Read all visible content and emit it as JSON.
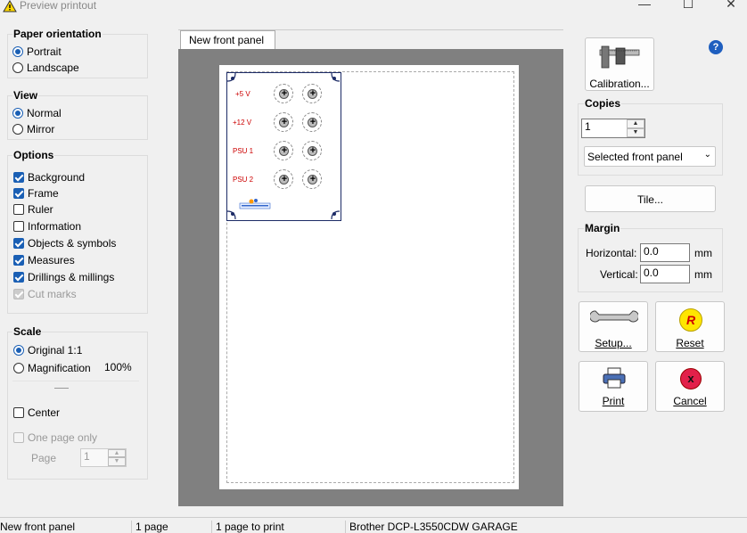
{
  "window": {
    "title": "Preview printout",
    "minimize": "—",
    "maximize": "☐",
    "close": "✕"
  },
  "paper_orientation": {
    "title": "Paper orientation",
    "options": [
      "Portrait",
      "Landscape"
    ],
    "selected": "Portrait"
  },
  "view": {
    "title": "View",
    "options": [
      "Normal",
      "Mirror"
    ],
    "selected": "Normal"
  },
  "options": {
    "title": "Options",
    "items": [
      {
        "label": "Background",
        "checked": true
      },
      {
        "label": "Frame",
        "checked": true
      },
      {
        "label": "Ruler",
        "checked": false
      },
      {
        "label": "Information",
        "checked": false
      },
      {
        "label": "Objects & symbols",
        "checked": true
      },
      {
        "label": "Measures",
        "checked": true
      },
      {
        "label": "Drillings & millings",
        "checked": true
      },
      {
        "label": "Cut marks",
        "checked": true,
        "disabled": true
      }
    ]
  },
  "scale": {
    "title": "Scale",
    "original": "Original 1:1",
    "magnification": "Magnification",
    "magnification_value": "100%",
    "selected": "Original 1:1",
    "center": "Center",
    "one_page_only": "One page only",
    "page_label": "Page",
    "page_value": "1"
  },
  "preview": {
    "tab": "New front panel",
    "panel_labels": [
      "+5 V",
      "+12 V",
      "PSU 1",
      "PSU 2"
    ]
  },
  "right": {
    "calibration": "Calibration...",
    "copies_title": "Copies",
    "copies_value": "1",
    "copies_select": "Selected front panel",
    "tile": "Tile...",
    "margin_title": "Margin",
    "horizontal_label": "Horizontal:",
    "horizontal_value": "0.0",
    "vertical_label": "Vertical:",
    "vertical_value": "0.0",
    "unit": "mm",
    "setup": "Setup...",
    "reset": "Reset",
    "print": "Print",
    "cancel": "Cancel",
    "help": "?"
  },
  "status": [
    "New front panel",
    "1 page",
    "1 page to print",
    "Brother DCP-L3550CDW GARAGE"
  ],
  "colors": {
    "accent": "#1a5fb4",
    "viewport": "#808080",
    "panel_border": "#1c2b66",
    "label_red": "#cc0000"
  }
}
